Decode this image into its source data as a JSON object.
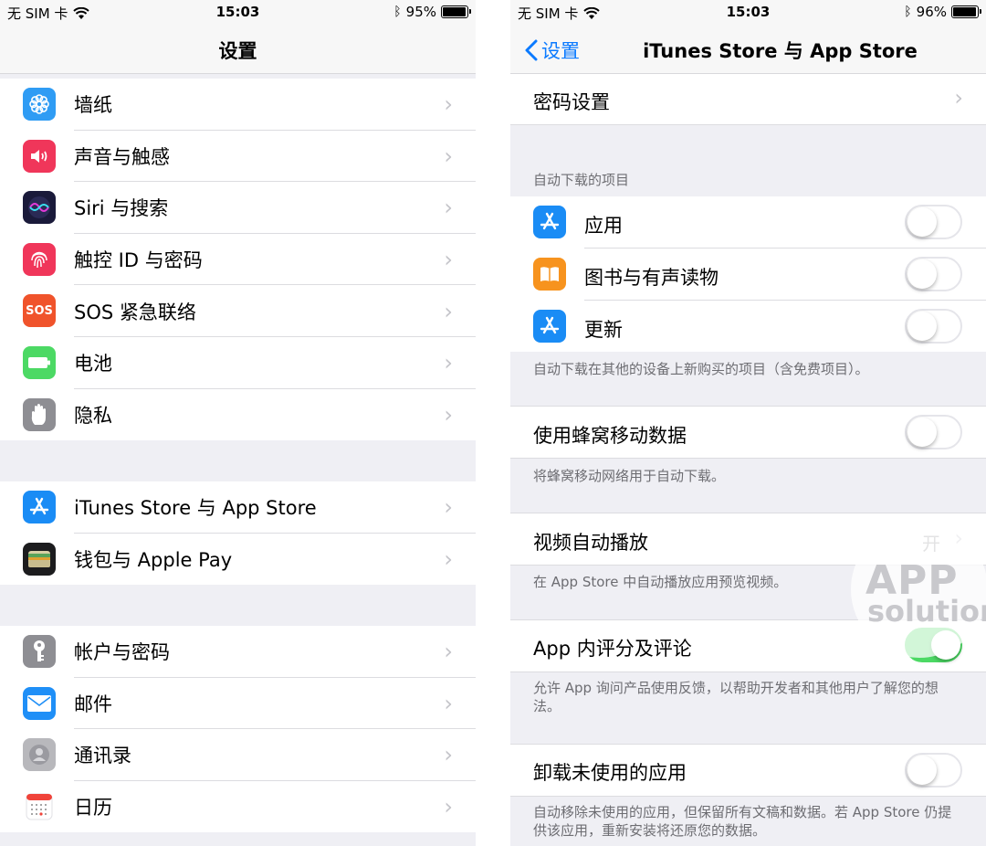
{
  "left": {
    "status": {
      "carrier": "无 SIM 卡",
      "time": "15:03",
      "battery": "95%",
      "battery_level": 0.95
    },
    "title": "设置",
    "groups": [
      {
        "items": [
          {
            "label": "墙纸",
            "icon": "wallpaper-icon",
            "color": "#2f9cf4"
          },
          {
            "label": "声音与触感",
            "icon": "sound-icon",
            "color": "#f0365a"
          },
          {
            "label": "Siri 与搜索",
            "icon": "siri-icon",
            "color": "#1a1a3a"
          },
          {
            "label": "触控 ID 与密码",
            "icon": "fingerprint-icon",
            "color": "#f0365a"
          },
          {
            "label": "SOS 紧急联络",
            "icon": "sos-icon",
            "color": "#f0532b",
            "icon_text": "SOS"
          },
          {
            "label": "电池",
            "icon": "battery-icon",
            "color": "#4cd964"
          },
          {
            "label": "隐私",
            "icon": "hand-icon",
            "color": "#8e8e93"
          }
        ]
      },
      {
        "items": [
          {
            "label": "iTunes Store 与 App Store",
            "icon": "app-store-icon",
            "color": "#1a8cf5"
          },
          {
            "label": "钱包与 Apple Pay",
            "icon": "wallet-icon",
            "color": "#1c1c1e"
          }
        ]
      },
      {
        "items": [
          {
            "label": "帐户与密码",
            "icon": "key-icon",
            "color": "#8e8e93"
          },
          {
            "label": "邮件",
            "icon": "mail-icon",
            "color": "#1f8ff7"
          },
          {
            "label": "通讯录",
            "icon": "contacts-icon",
            "color": "#b8b8bc"
          },
          {
            "label": "日历",
            "icon": "calendar-icon",
            "color": "#ffffff"
          }
        ]
      }
    ]
  },
  "right": {
    "status": {
      "carrier": "无 SIM 卡",
      "time": "15:03",
      "battery": "96%",
      "battery_level": 0.96
    },
    "back_label": "设置",
    "title": "iTunes Store 与 App Store",
    "password_settings": "密码设置",
    "auto_download_header": "自动下载的项目",
    "auto_items": [
      {
        "label": "应用",
        "icon": "app-store-icon",
        "on": false
      },
      {
        "label": "图书与有声读物",
        "icon": "books-icon",
        "on": false
      },
      {
        "label": "更新",
        "icon": "app-store-icon",
        "on": false
      }
    ],
    "auto_footer": "自动下载在其他的设备上新购买的项目（含免费项目）。",
    "cellular_label": "使用蜂窝移动数据",
    "cellular_on": false,
    "cellular_footer": "将蜂窝移动网络用于自动下载。",
    "video_label": "视频自动播放",
    "video_value": "开",
    "video_footer": "在 App Store 中自动播放应用预览视频。",
    "ratings_label": "App 内评分及评论",
    "ratings_on": true,
    "ratings_footer": "允许 App 询问产品使用反馈，以帮助开发者和其他用户了解您的想法。",
    "offload_label": "卸载未使用的应用",
    "offload_on": false,
    "offload_footer": "自动移除未使用的应用，但保留所有文稿和数据。若 App Store 仍提供该应用，重新安装将还原您的数据。"
  },
  "watermark": {
    "line1": "APP",
    "line2": "solution"
  },
  "colors": {
    "ios_blue": "#0a7aff",
    "toggle_on": "#4cd964",
    "group_bg": "#efeff4"
  }
}
